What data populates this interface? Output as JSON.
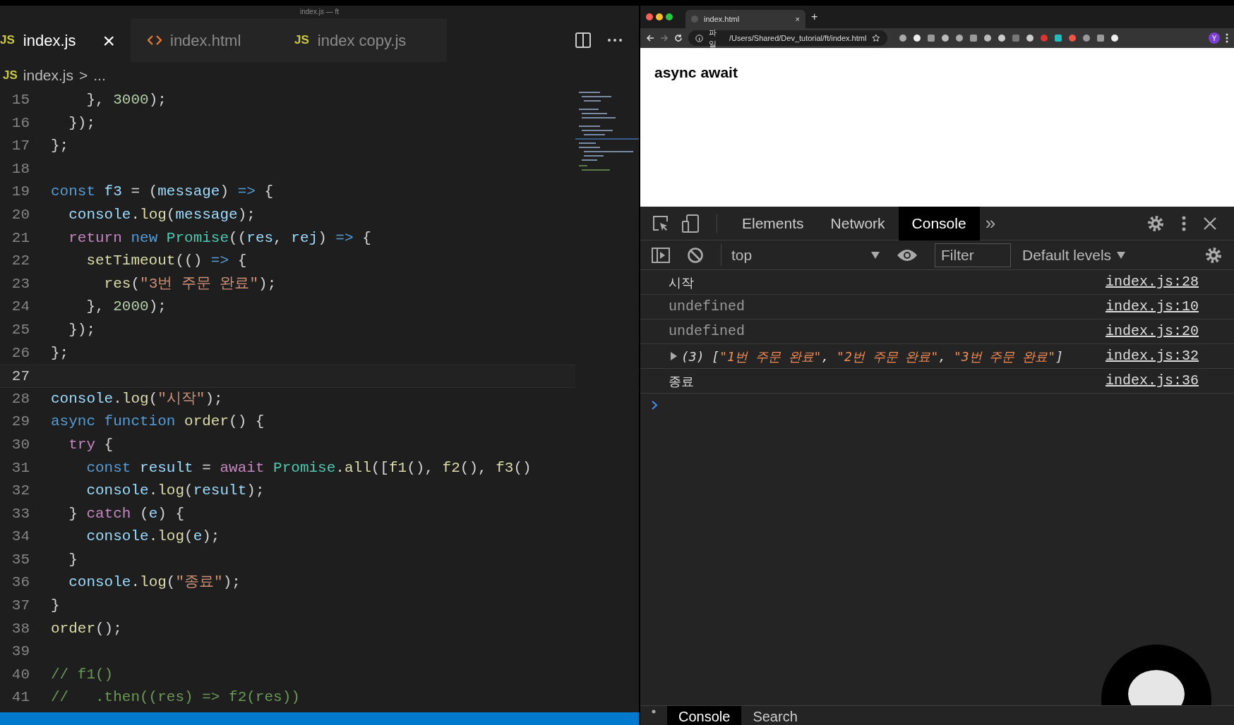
{
  "window": {
    "title": "index.js — ft"
  },
  "editor": {
    "tabs": [
      {
        "icon_text": "JS",
        "kind": "js",
        "label": "index.js",
        "selected": true,
        "close": "×"
      },
      {
        "kind": "html",
        "label": "index.html",
        "selected": false
      },
      {
        "icon_text": "JS",
        "kind": "js",
        "label": "index copy.js",
        "selected": false
      }
    ],
    "breadcrumb": {
      "icon_text": "JS",
      "file": "index.js",
      "separator": ">",
      "rest": "..."
    },
    "lines": [
      {
        "number": "15",
        "current": false,
        "tokens": [
          {
            "text": "    }, ",
            "color": "#d4d4d4"
          },
          {
            "text": "3000",
            "color": "#b5cea8"
          },
          {
            "text": ");",
            "color": "#d4d4d4"
          }
        ]
      },
      {
        "number": "16",
        "current": false,
        "tokens": [
          {
            "text": "  });",
            "color": "#d4d4d4"
          }
        ]
      },
      {
        "number": "17",
        "current": false,
        "tokens": [
          {
            "text": "};",
            "color": "#d4d4d4"
          }
        ]
      },
      {
        "number": "18",
        "current": false
      },
      {
        "number": "19",
        "current": false,
        "tokens": [
          {
            "text": "const",
            "color": "#569cd6"
          },
          {
            "text": " f3 ",
            "color": "#9cdcfe"
          },
          {
            "text": "= (",
            "color": "#d4d4d4"
          },
          {
            "text": "message",
            "color": "#9cdcfe"
          },
          {
            "text": ") ",
            "color": "#d4d4d4"
          },
          {
            "text": "=>",
            "color": "#569cd6"
          },
          {
            "text": " {",
            "color": "#d4d4d4"
          }
        ]
      },
      {
        "number": "20",
        "current": false,
        "tokens": [
          {
            "text": "  console",
            "color": "#9cdcfe"
          },
          {
            "text": ".",
            "color": "#d4d4d4"
          },
          {
            "text": "log",
            "color": "#dcdcaa"
          },
          {
            "text": "(",
            "color": "#d4d4d4"
          },
          {
            "text": "message",
            "color": "#9cdcfe"
          },
          {
            "text": ");",
            "color": "#d4d4d4"
          }
        ]
      },
      {
        "number": "21",
        "current": false,
        "tokens": [
          {
            "text": "  return",
            "color": "#c586c0"
          },
          {
            "text": " new ",
            "color": "#569cd6"
          },
          {
            "text": "Promise",
            "color": "#4ec9b0"
          },
          {
            "text": "((",
            "color": "#d4d4d4"
          },
          {
            "text": "res",
            "color": "#9cdcfe"
          },
          {
            "text": ", ",
            "color": "#d4d4d4"
          },
          {
            "text": "rej",
            "color": "#9cdcfe"
          },
          {
            "text": ") ",
            "color": "#d4d4d4"
          },
          {
            "text": "=>",
            "color": "#569cd6"
          },
          {
            "text": " {",
            "color": "#d4d4d4"
          }
        ]
      },
      {
        "number": "22",
        "current": false,
        "tokens": [
          {
            "text": "    setTimeout",
            "color": "#dcdcaa"
          },
          {
            "text": "(() ",
            "color": "#d4d4d4"
          },
          {
            "text": "=>",
            "color": "#569cd6"
          },
          {
            "text": " {",
            "color": "#d4d4d4"
          }
        ]
      },
      {
        "number": "23",
        "current": false,
        "tokens": [
          {
            "text": "      res",
            "color": "#dcdcaa"
          },
          {
            "text": "(",
            "color": "#d4d4d4"
          },
          {
            "text": "\"3번 주문 완료\"",
            "color": "#ce9178"
          },
          {
            "text": ");",
            "color": "#d4d4d4"
          }
        ]
      },
      {
        "number": "24",
        "current": false,
        "tokens": [
          {
            "text": "    }, ",
            "color": "#d4d4d4"
          },
          {
            "text": "2000",
            "color": "#b5cea8"
          },
          {
            "text": ");",
            "color": "#d4d4d4"
          }
        ]
      },
      {
        "number": "25",
        "current": false,
        "tokens": [
          {
            "text": "  });",
            "color": "#d4d4d4"
          }
        ]
      },
      {
        "number": "26",
        "current": false,
        "tokens": [
          {
            "text": "};",
            "color": "#d4d4d4"
          }
        ]
      },
      {
        "number": "27",
        "current": true
      },
      {
        "number": "28",
        "current": false,
        "tokens": [
          {
            "text": "console",
            "color": "#9cdcfe"
          },
          {
            "text": ".",
            "color": "#d4d4d4"
          },
          {
            "text": "log",
            "color": "#dcdcaa"
          },
          {
            "text": "(",
            "color": "#d4d4d4"
          },
          {
            "text": "\"시작\"",
            "color": "#ce9178"
          },
          {
            "text": ");",
            "color": "#d4d4d4"
          }
        ]
      },
      {
        "number": "29",
        "current": false,
        "tokens": [
          {
            "text": "async function",
            "color": "#569cd6"
          },
          {
            "text": " order",
            "color": "#dcdcaa"
          },
          {
            "text": "() {",
            "color": "#d4d4d4"
          }
        ]
      },
      {
        "number": "30",
        "current": false,
        "tokens": [
          {
            "text": "  try",
            "color": "#c586c0"
          },
          {
            "text": " {",
            "color": "#d4d4d4"
          }
        ]
      },
      {
        "number": "31",
        "current": false,
        "tokens": [
          {
            "text": "    const",
            "color": "#569cd6"
          },
          {
            "text": " result ",
            "color": "#9cdcfe"
          },
          {
            "text": "= ",
            "color": "#d4d4d4"
          },
          {
            "text": "await",
            "color": "#c586c0"
          },
          {
            "text": " Promise",
            "color": "#4ec9b0"
          },
          {
            "text": ".",
            "color": "#d4d4d4"
          },
          {
            "text": "all",
            "color": "#dcdcaa"
          },
          {
            "text": "([",
            "color": "#d4d4d4"
          },
          {
            "text": "f1",
            "color": "#dcdcaa"
          },
          {
            "text": "(), ",
            "color": "#d4d4d4"
          },
          {
            "text": "f2",
            "color": "#dcdcaa"
          },
          {
            "text": "(), ",
            "color": "#d4d5d4"
          },
          {
            "text": "f3",
            "color": "#dcdcaa"
          },
          {
            "text": "()",
            "color": "#d4d4d4"
          }
        ]
      },
      {
        "number": "32",
        "current": false,
        "tokens": [
          {
            "text": "    console",
            "color": "#9cdcfe"
          },
          {
            "text": ".",
            "color": "#d4d4d4"
          },
          {
            "text": "log",
            "color": "#dcdcaa"
          },
          {
            "text": "(",
            "color": "#d4d4d4"
          },
          {
            "text": "result",
            "color": "#9cdcfe"
          },
          {
            "text": ");",
            "color": "#d4d4d4"
          }
        ]
      },
      {
        "number": "33",
        "current": false,
        "tokens": [
          {
            "text": "  } ",
            "color": "#d4d4d4"
          },
          {
            "text": "catch",
            "color": "#c586c0"
          },
          {
            "text": " (",
            "color": "#d4d4d4"
          },
          {
            "text": "e",
            "color": "#9cdcfe"
          },
          {
            "text": ") {",
            "color": "#d4d4d4"
          }
        ]
      },
      {
        "number": "34",
        "current": false,
        "tokens": [
          {
            "text": "    console",
            "color": "#9cdcfe"
          },
          {
            "text": ".",
            "color": "#d4d4d4"
          },
          {
            "text": "log",
            "color": "#dcdcaa"
          },
          {
            "text": "(",
            "color": "#d4d4d4"
          },
          {
            "text": "e",
            "color": "#9cdcfe"
          },
          {
            "text": ");",
            "color": "#d4d4d4"
          }
        ]
      },
      {
        "number": "35",
        "current": false,
        "tokens": [
          {
            "text": "  }",
            "color": "#d4d4d4"
          }
        ]
      },
      {
        "number": "36",
        "current": false,
        "tokens": [
          {
            "text": "  console",
            "color": "#9cdcfe"
          },
          {
            "text": ".",
            "color": "#d4d4d4"
          },
          {
            "text": "log",
            "color": "#dcdcaa"
          },
          {
            "text": "(",
            "color": "#d4d4d4"
          },
          {
            "text": "\"종료\"",
            "color": "#ce9178"
          },
          {
            "text": ");",
            "color": "#d4d4d4"
          }
        ]
      },
      {
        "number": "37",
        "current": false,
        "tokens": [
          {
            "text": "}",
            "color": "#d4d4d4"
          }
        ]
      },
      {
        "number": "38",
        "current": false,
        "tokens": [
          {
            "text": "order",
            "color": "#dcdcaa"
          },
          {
            "text": "();",
            "color": "#d4d4d4"
          }
        ]
      },
      {
        "number": "39",
        "current": false
      },
      {
        "number": "40",
        "current": false,
        "tokens": [
          {
            "text": "// f1()",
            "color": "#6a9955"
          }
        ]
      },
      {
        "number": "41",
        "current": false,
        "tokens": [
          {
            "text": "//   .then((res) => f2(res))",
            "color": "#6a9955"
          }
        ]
      }
    ]
  },
  "browser": {
    "tab": {
      "label": "index.html",
      "close": "×",
      "new_tab": "+"
    },
    "address": {
      "scheme": "파일",
      "url": "/Users/Shared/Dev_tutorial/ft/index.html"
    },
    "profile": "Y",
    "page": {
      "heading": "async await"
    }
  },
  "devtools": {
    "tabs": [
      {
        "label": "Elements",
        "selected": false
      },
      {
        "label": "Network",
        "selected": false
      },
      {
        "label": "Console",
        "selected": true
      }
    ],
    "more_tabs": "»",
    "context": "top",
    "filter": {
      "placeholder": "Filter"
    },
    "levels": "Default levels",
    "messages": [
      {
        "kind": "text",
        "tokens": [
          {
            "text": "시작",
            "color": "#dddddd"
          }
        ],
        "source": "index.js:28"
      },
      {
        "kind": "undefined",
        "tokens": [
          {
            "text": "undefined",
            "color": "#9a9a9a"
          }
        ],
        "source": "index.js:10"
      },
      {
        "kind": "undefined",
        "tokens": [
          {
            "text": "undefined",
            "color": "#9a9a9a"
          }
        ],
        "source": "index.js:20"
      },
      {
        "kind": "array",
        "expanded": false,
        "tokens": [
          {
            "text": "(3) [",
            "color": "#dddddd"
          },
          {
            "text": "\"1번 주문 완료\"",
            "color": "#f28b54"
          },
          {
            "text": ", ",
            "color": "#dddddd"
          },
          {
            "text": "\"2번 주문 완료\"",
            "color": "#f28b54"
          },
          {
            "text": ", ",
            "color": "#dddddd"
          },
          {
            "text": "\"3번 주문 완료\"",
            "color": "#f28b54"
          },
          {
            "text": "]",
            "color": "#dddddd"
          }
        ],
        "source": "index.js:32"
      },
      {
        "kind": "text",
        "tokens": [
          {
            "text": "종료",
            "color": "#dddddd"
          }
        ],
        "source": "index.js:36"
      }
    ],
    "drawer_tabs": [
      {
        "label": "Console",
        "selected": true
      },
      {
        "label": "Search",
        "selected": false
      }
    ]
  }
}
